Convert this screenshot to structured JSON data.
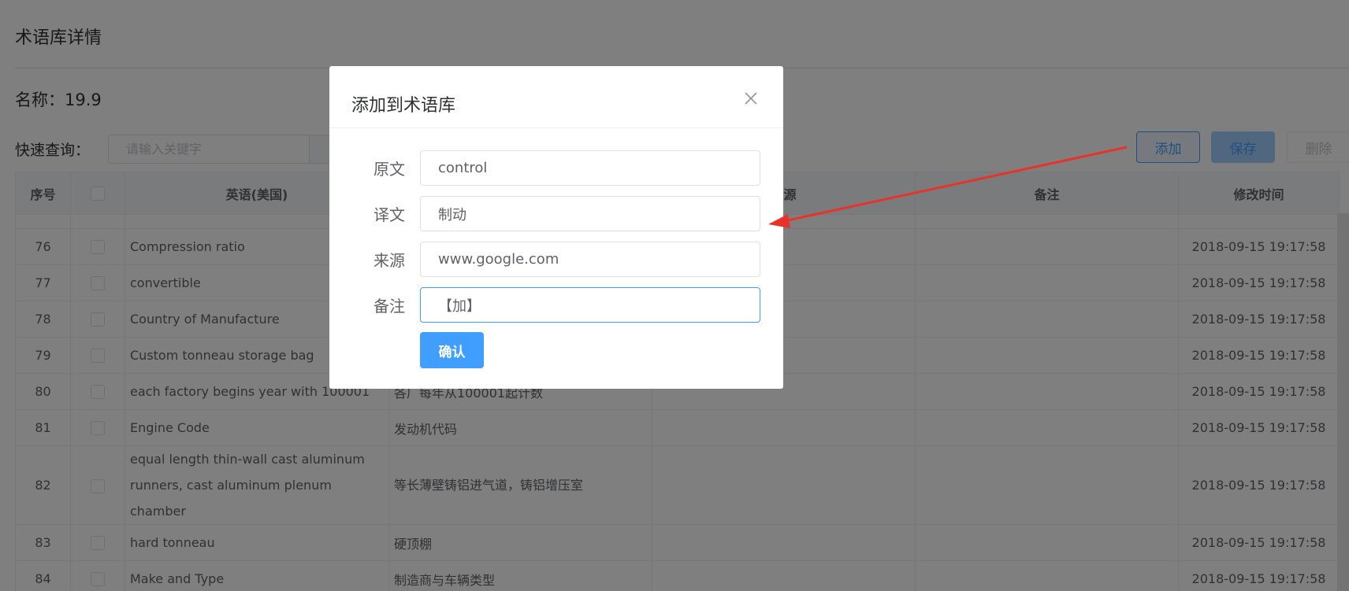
{
  "page": {
    "title": "术语库详情",
    "name_line": "名称：19.9",
    "search_label": "快速查询：",
    "search_placeholder": "请输入关键字"
  },
  "toolbar": {
    "add_label": "添加",
    "save_label": "保存",
    "delete_label": "删除"
  },
  "table": {
    "columns": [
      "序号",
      "",
      "英语(美国)",
      "",
      "来源",
      "备注",
      "修改时间"
    ],
    "rows": [
      {
        "idx": "76",
        "en": "Compression ratio",
        "zh": "",
        "source": "",
        "note": "",
        "time": "2018-09-15 19:17:58"
      },
      {
        "idx": "77",
        "en": "convertible",
        "zh": "",
        "source": "",
        "note": "",
        "time": "2018-09-15 19:17:58"
      },
      {
        "idx": "78",
        "en": "Country of Manufacture",
        "zh": "",
        "source": "",
        "note": "",
        "time": "2018-09-15 19:17:58"
      },
      {
        "idx": "79",
        "en": "Custom tonneau storage bag",
        "zh": "",
        "source": "",
        "note": "",
        "time": "2018-09-15 19:17:58"
      },
      {
        "idx": "80",
        "en": "each factory begins year with 100001",
        "zh": "各厂每年从100001起计数",
        "source": "",
        "note": "",
        "time": "2018-09-15 19:17:58"
      },
      {
        "idx": "81",
        "en": "Engine Code",
        "zh": "发动机代码",
        "source": "",
        "note": "",
        "time": "2018-09-15 19:17:58"
      },
      {
        "idx": "82",
        "en": "equal length thin-wall cast aluminum runners, cast aluminum plenum chamber",
        "zh": "等长薄壁铸铝进气道，铸铝增压室",
        "source": "",
        "note": "",
        "time": "2018-09-15 19:17:58"
      },
      {
        "idx": "83",
        "en": "hard tonneau",
        "zh": "硬顶棚",
        "source": "",
        "note": "",
        "time": "2018-09-15 19:17:58"
      },
      {
        "idx": "84",
        "en": "Make and Type",
        "zh": "制造商与车辆类型",
        "source": "",
        "note": "",
        "time": "2018-09-15 19:17:58"
      }
    ]
  },
  "dialog": {
    "title": "添加到术语库",
    "fields": [
      {
        "label": "原文",
        "value": "control"
      },
      {
        "label": "译文",
        "value": "制动"
      },
      {
        "label": "来源",
        "value": "www.google.com"
      },
      {
        "label": "备注",
        "value": "【加】"
      }
    ],
    "confirm_label": "确认"
  },
  "colors": {
    "primary": "#409eff",
    "annotation_arrow": "#e8322a"
  }
}
